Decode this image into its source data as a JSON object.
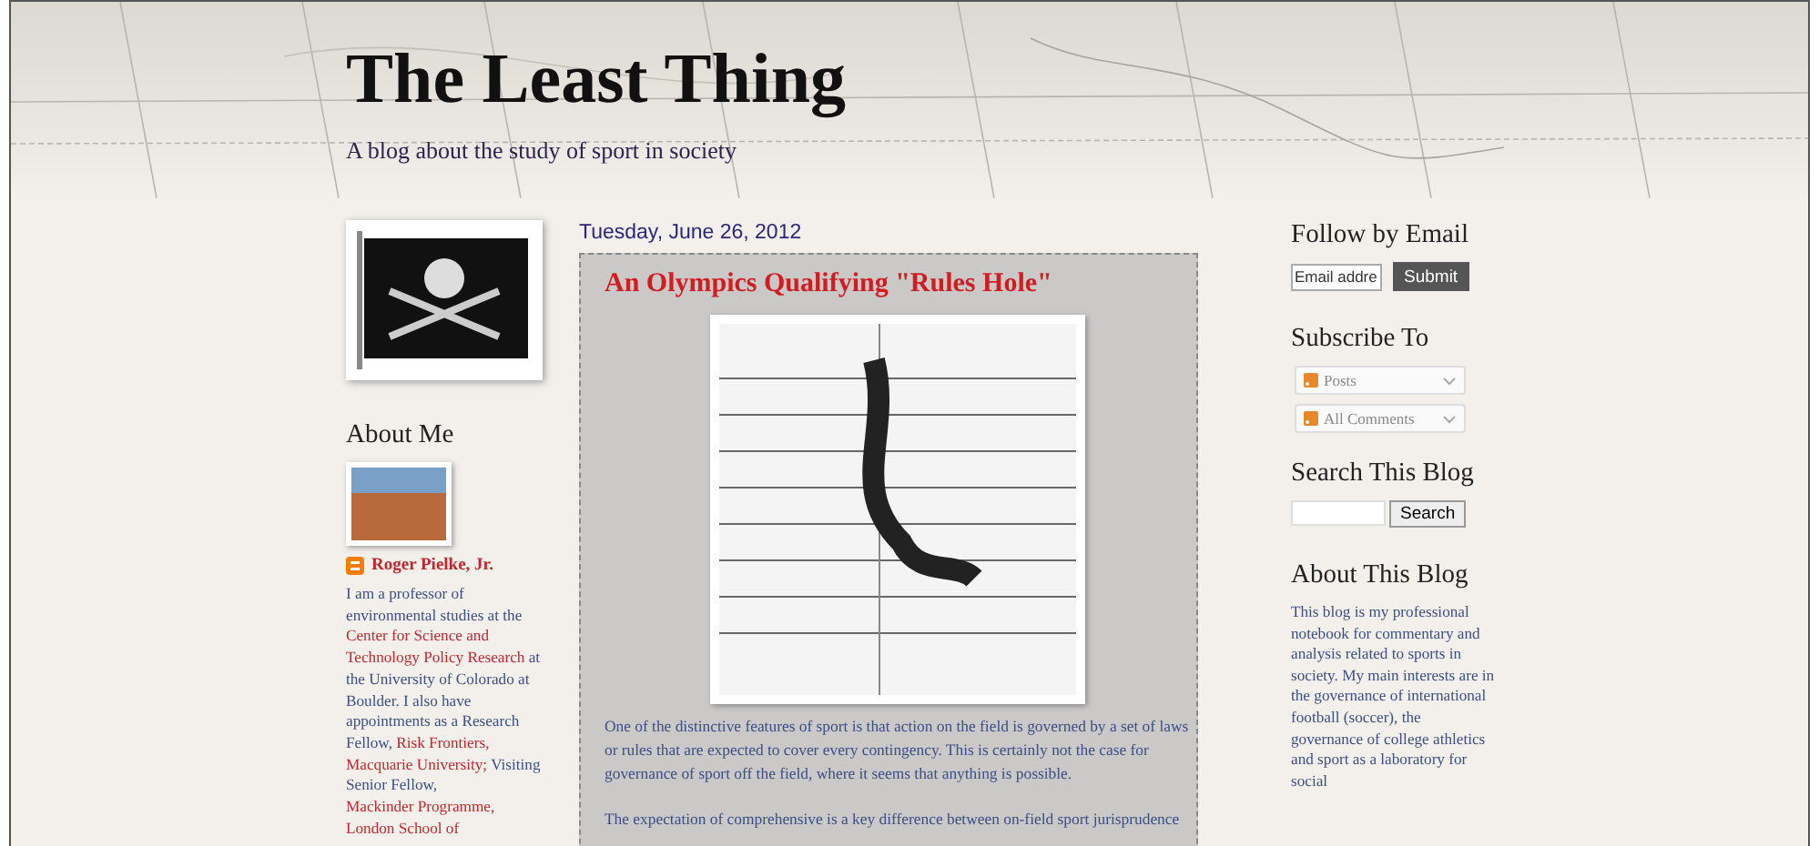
{
  "header": {
    "title": "The Least Thing",
    "description": "A blog about the study of sport in society"
  },
  "sidebar_left": {
    "about_me": {
      "heading": "About Me",
      "profile_name": "Roger Pielke, Jr.",
      "bio": [
        {
          "text": "I am a professor of environmental studies at the",
          "link": false
        },
        {
          "text": "Center for Science and",
          "link": true
        },
        {
          "text": "Technology Policy Research",
          "link": true
        },
        {
          "text": "at the University of Colorado at Boulder. I also have appointments as a Research Fellow,",
          "link": false
        },
        {
          "text": "Risk Frontiers,",
          "link": true
        },
        {
          "text": "Macquarie University;",
          "link": true
        },
        {
          "text": "Visiting Senior Fellow,",
          "link": false
        },
        {
          "text": "Mackinder Programme,",
          "link": true
        },
        {
          "text": "London School of",
          "link": true
        }
      ]
    }
  },
  "post": {
    "date": "Tuesday, June 26, 2012",
    "title": "An Olympics Qualifying \"Rules Hole\"",
    "paragraphs": [
      "One of the distinctive features of sport is that action on the field is governed by a set of laws or rules that are expected to cover every contingency. This is certainly not the case for governance of sport off the field, where it seems that anything is possible.",
      "The expectation of comprehensive is a key difference between on-field sport jurisprudence"
    ]
  },
  "sidebar_right": {
    "follow": {
      "heading": "Follow by Email",
      "placeholder": "Email addre",
      "button": "Submit"
    },
    "subscribe": {
      "heading": "Subscribe To",
      "items": [
        {
          "label": "Posts",
          "expanded": false
        },
        {
          "label": "All Comments",
          "expanded": false
        }
      ]
    },
    "search": {
      "heading": "Search This Blog",
      "button": "Search"
    },
    "about_blog": {
      "heading": "About This Blog",
      "text": "This blog is my professional notebook for commentary and analysis related to sports in society. My main interests are in the governance of international football (soccer), the governance of college athletics and sport as a laboratory for social"
    }
  }
}
